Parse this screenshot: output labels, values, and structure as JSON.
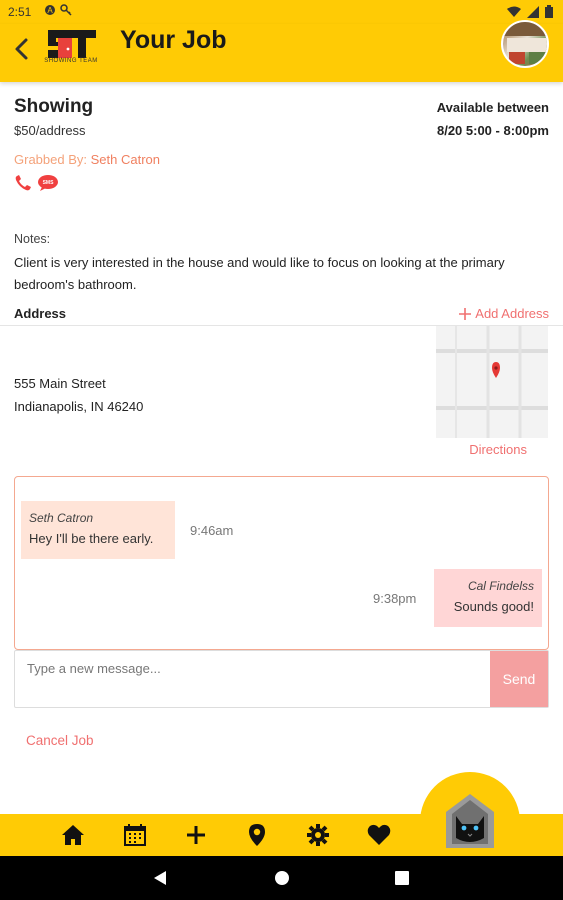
{
  "status_bar": {
    "time": "2:51"
  },
  "header": {
    "title": "Your Job",
    "logo_sub": "SHOWING TEAM"
  },
  "job": {
    "type": "Showing",
    "price": "$50/address",
    "available_label": "Available between",
    "available_value": "8/20  5:00 - 8:00pm",
    "grabbed_prefix": "Grabbed By: ",
    "grabbed_name": "Seth Catron",
    "notes_label": "Notes:",
    "notes_text": "Client is very interested in the house and would like to focus on looking at the primary bedroom's bathroom."
  },
  "address": {
    "label": "Address",
    "add_label": "Add Address",
    "line1": "555 Main Street",
    "line2": "Indianapolis, IN 46240",
    "directions": "Directions"
  },
  "chat": {
    "messages": [
      {
        "sender": "Seth Catron",
        "text": "Hey I'll be there early.",
        "time": "9:46am"
      },
      {
        "sender": "Cal Findelss",
        "text": "Sounds good!",
        "time": "9:38pm"
      }
    ],
    "input_placeholder": "Type a new message...",
    "send_label": "Send"
  },
  "cancel_label": "Cancel Job",
  "colors": {
    "brand_yellow": "#FFCB05",
    "accent_red": "#F07070",
    "accent_orange": "#F4A27A"
  },
  "bottom_nav": [
    "home-icon",
    "calendar-icon",
    "plus-icon",
    "location-pin-icon",
    "gear-icon",
    "heart-icon"
  ]
}
